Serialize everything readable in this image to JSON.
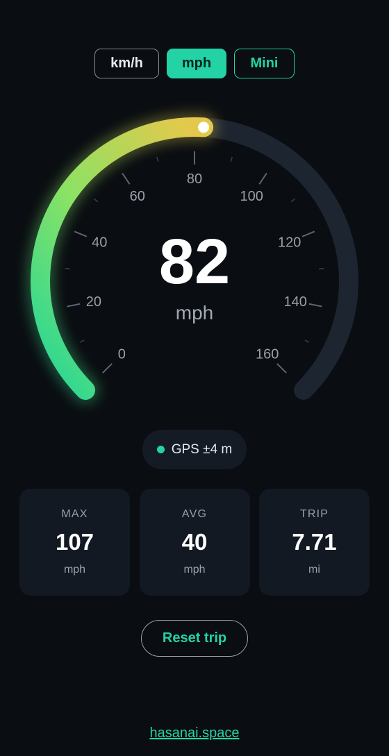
{
  "unit_toggle": {
    "options": [
      {
        "label": "km/h",
        "state": "outline"
      },
      {
        "label": "mph",
        "state": "selected"
      },
      {
        "label": "Mini",
        "state": "accent-outline"
      }
    ]
  },
  "gauge": {
    "min": 0,
    "max": 160,
    "current": 82,
    "unit": "mph",
    "labels": [
      "0",
      "20",
      "40",
      "60",
      "80",
      "100",
      "120",
      "140",
      "160"
    ],
    "minor_step": 10,
    "colors": {
      "track": "#1d2530",
      "start": "#1fd69a",
      "mid": "#8ce264",
      "end": "#e3c94b",
      "knob": "#ffffff"
    }
  },
  "gps": {
    "label": "GPS ±4 m",
    "status_color": "#23d3a6"
  },
  "stats": [
    {
      "label": "MAX",
      "value": "107",
      "unit": "mph"
    },
    {
      "label": "AVG",
      "value": "40",
      "unit": "mph"
    },
    {
      "label": "TRIP",
      "value": "7.71",
      "unit": "mi"
    }
  ],
  "reset_label": "Reset trip",
  "footer_link": "hasanai.space",
  "colors": {
    "accent": "#23d3a6",
    "background": "#0a0d11",
    "card": "#131922"
  }
}
